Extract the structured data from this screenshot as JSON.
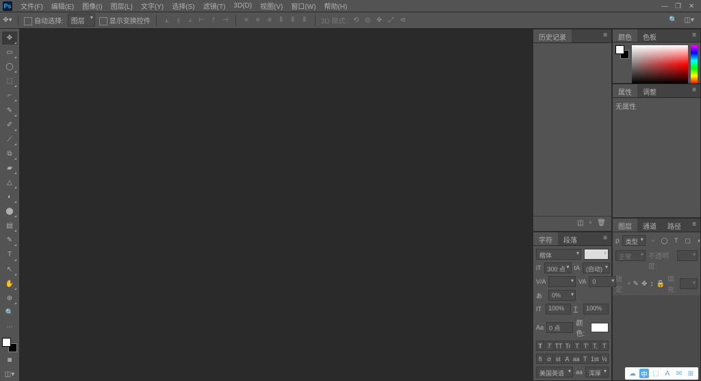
{
  "menubar": {
    "logo": "Ps",
    "items": [
      "文件(F)",
      "编辑(E)",
      "图像(I)",
      "图层(L)",
      "文字(Y)",
      "选择(S)",
      "滤镜(T)",
      "3D(D)",
      "视图(V)",
      "窗口(W)",
      "帮助(H)"
    ]
  },
  "window_controls": {
    "min": "—",
    "restore": "❐",
    "close": "✕"
  },
  "optionbar": {
    "autoselect_label": "自动选择:",
    "autoselect_value": "图层",
    "transform_label": "显示变换控件",
    "mode_3d_label": "3D 模式:"
  },
  "tools": [
    "✥",
    "▭",
    "◯",
    "⬚",
    "⌐",
    "✎",
    "✐",
    "⟋",
    "⧉",
    "▰",
    "△",
    "◐",
    "⬤",
    "▤",
    "✎",
    "T",
    "↖",
    "✋",
    "⊕",
    "🔍"
  ],
  "panels": {
    "history": {
      "tabs": [
        "历史记录"
      ]
    },
    "color": {
      "tabs": [
        "颜色",
        "色板"
      ]
    },
    "properties": {
      "tabs": [
        "属性",
        "调整"
      ],
      "empty": "无属性"
    },
    "character": {
      "tabs": [
        "字符",
        "段落"
      ],
      "font": "楷体",
      "font_style": "",
      "size_icon": "iT",
      "size": "300 点",
      "leading_icon": "tA",
      "leading": "(自动)",
      "kern_icon": "V/A",
      "kern": "",
      "track_icon": "VA",
      "track": "0",
      "other_icon": "あ",
      "other": "0%",
      "vscale_icon": "IT",
      "vscale": "100%",
      "hscale_icon": "T",
      "hscale": "100%",
      "baseline_icon": "Aa",
      "baseline": "0 点",
      "color_label": "颜色:",
      "style_btns": [
        "T",
        "T",
        "TT",
        "Tr",
        "T",
        "T'",
        "T,",
        "T"
      ],
      "feature_btns": [
        "fi",
        "σ",
        "st",
        "A",
        "aa",
        "T",
        "1st",
        "½"
      ],
      "lang": "美国英语",
      "aa": "aa",
      "aa_value": "浑厚"
    },
    "layers": {
      "tabs": [
        "图层",
        "通道",
        "路径"
      ],
      "search_icon": "ρ",
      "search_label": "类型",
      "filter_icons": [
        "▫",
        "◯",
        "T",
        "▢",
        "◐"
      ],
      "mode": "正常",
      "opacity_label": "不透明度:",
      "lock_label": "锁定:",
      "lock_icons": [
        "▫",
        "✎",
        "✥",
        "↕",
        "🔒"
      ],
      "fill_label": "填充:"
    }
  },
  "taskbar": {
    "icons": [
      "☁",
      "中",
      "⬚",
      "A",
      "✉",
      "⊞"
    ]
  }
}
